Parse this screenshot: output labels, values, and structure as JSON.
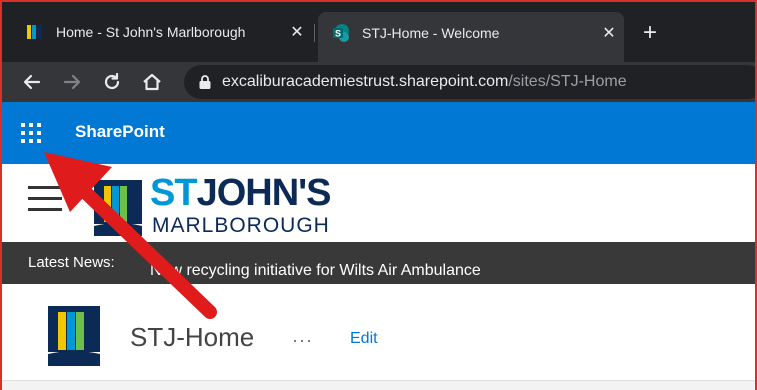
{
  "browser": {
    "tabs": [
      {
        "title": "Home - St John's Marlborough",
        "close": "✕"
      },
      {
        "title": "STJ-Home - Welcome",
        "close": "✕",
        "favicon_letter": "S"
      }
    ],
    "new_tab": "+",
    "url_host": "excaliburacademiestrust.sharepoint.com",
    "url_path": "/sites/STJ-Home"
  },
  "sharepoint": {
    "title": "SharePoint"
  },
  "school_header": {
    "logo_st": "ST",
    "logo_johns": "JOHN'S",
    "logo_sub": "MARLBOROUGH"
  },
  "news": {
    "label": "Latest News:",
    "text": "New recycling initiative for Wilts Air Ambulance"
  },
  "site": {
    "title": "STJ-Home",
    "more": "···",
    "edit": "Edit"
  },
  "colors": {
    "sharepoint_blue": "#0078d4",
    "annotation_red": "#e01b1b",
    "logo_navy": "#0b2a55",
    "logo_cyan": "#0097d7"
  }
}
